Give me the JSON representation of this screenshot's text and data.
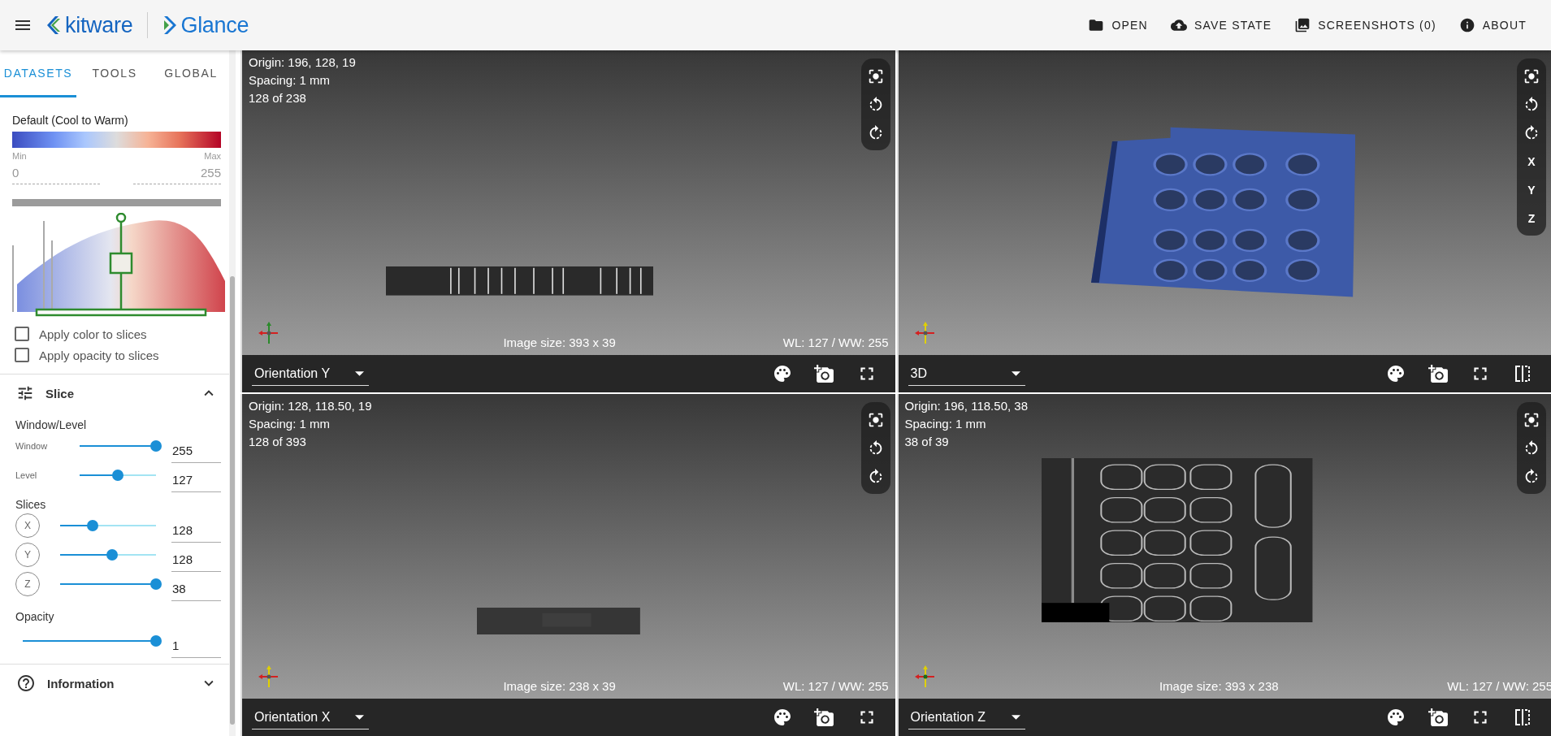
{
  "app_bar": {
    "brand": "kitware",
    "product": "Glance",
    "actions": [
      {
        "kind": "open",
        "label": "OPEN"
      },
      {
        "kind": "save",
        "label": "SAVE STATE"
      },
      {
        "kind": "screenshots",
        "label": "SCREENSHOTS (0)"
      },
      {
        "kind": "about",
        "label": "ABOUT"
      }
    ]
  },
  "sidebar": {
    "tabs": [
      {
        "label": "DATASETS",
        "selected": true
      },
      {
        "label": "TOOLS",
        "selected": false
      },
      {
        "label": "GLOBAL",
        "selected": false
      }
    ],
    "colormap": {
      "name": "Default (Cool to Warm)",
      "min_label": "Min",
      "max_label": "Max",
      "min_value": "0",
      "max_value": "255"
    },
    "options": [
      {
        "label": "Apply color to slices",
        "checked": false
      },
      {
        "label": "Apply opacity to slices",
        "checked": false
      }
    ],
    "slice_panel": {
      "title": "Slice",
      "expanded": true,
      "window_level": {
        "title": "Window/Level",
        "sliders": [
          {
            "label": "Window",
            "level": 1,
            "value": "255"
          },
          {
            "label": "Level",
            "level": 0.5,
            "value": "127"
          }
        ]
      },
      "slices": {
        "title": "Slices",
        "sliders": [
          {
            "axis": "X",
            "level": 0.34,
            "value": "128"
          },
          {
            "axis": "Y",
            "level": 0.54,
            "value": "128"
          },
          {
            "axis": "Z",
            "level": 1,
            "value": "38"
          }
        ]
      },
      "opacity": {
        "title": "Opacity",
        "level": 1,
        "value": "1"
      }
    },
    "info_panel": {
      "title": "Information",
      "expanded": false
    }
  },
  "views": [
    {
      "kind": "slice",
      "lines": [
        "Origin: 196, 128, 19",
        "Spacing: 1 mm",
        "128 of 238"
      ],
      "image_size": "Image size: 393 x 39",
      "wl": "WL: 127 / WW: 255",
      "view_type": "Orientation Y"
    },
    {
      "kind": "volume",
      "axis_buttons": [
        "X",
        "Y",
        "Z"
      ],
      "view_type": "3D"
    },
    {
      "kind": "slice",
      "lines": [
        "Origin: 128, 118.50, 19",
        "Spacing: 1 mm",
        "128 of 393"
      ],
      "image_size": "Image size: 238 x 39",
      "wl": "WL: 127 / WW: 255",
      "view_type": "Orientation X"
    },
    {
      "kind": "slice",
      "lines": [
        "Origin: 196, 118.50, 38",
        "Spacing: 1 mm",
        "38 of 39"
      ],
      "image_size": "Image size: 393 x 238",
      "wl": "WL: 127 / WW: 255",
      "view_type": "Orientation Z"
    }
  ]
}
